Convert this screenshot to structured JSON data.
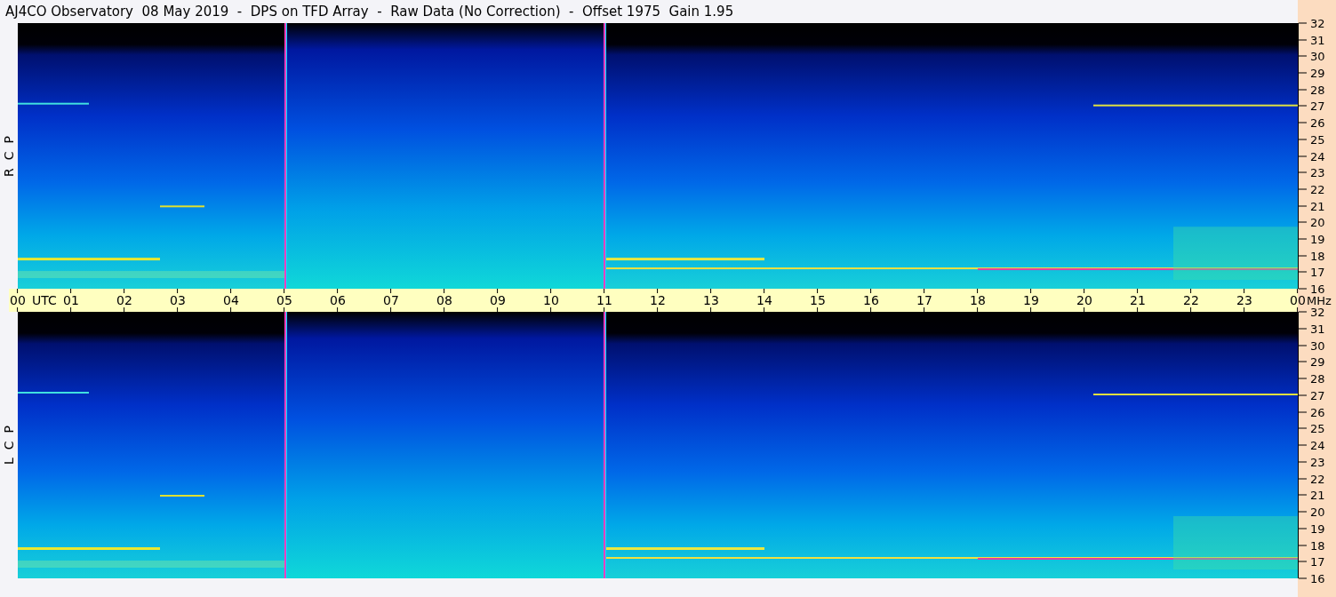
{
  "title": "AJ4CO Observatory  08 May 2019  -  DPS on TFD Array  -  Raw Data (No Correction)  -  Offset 1975  Gain 1.95",
  "panels": [
    {
      "label": "R  C  P",
      "frequency_ticks": [
        "32",
        "31",
        "30",
        "29",
        "28",
        "27",
        "26",
        "25",
        "24",
        "23",
        "22",
        "21",
        "20",
        "19",
        "18",
        "17",
        "16"
      ]
    },
    {
      "label": "L  C  P",
      "frequency_ticks": [
        "32",
        "31",
        "30",
        "29",
        "28",
        "27",
        "26",
        "25",
        "24",
        "23",
        "22",
        "21",
        "20",
        "19",
        "18",
        "17",
        "16"
      ]
    }
  ],
  "time_axis": {
    "ticks": [
      "00",
      "01",
      "02",
      "03",
      "04",
      "05",
      "06",
      "07",
      "08",
      "09",
      "10",
      "11",
      "12",
      "13",
      "14",
      "15",
      "16",
      "17",
      "18",
      "19",
      "20",
      "21",
      "22",
      "23",
      "00"
    ],
    "zone": "UTC",
    "unit": "MHz"
  }
}
